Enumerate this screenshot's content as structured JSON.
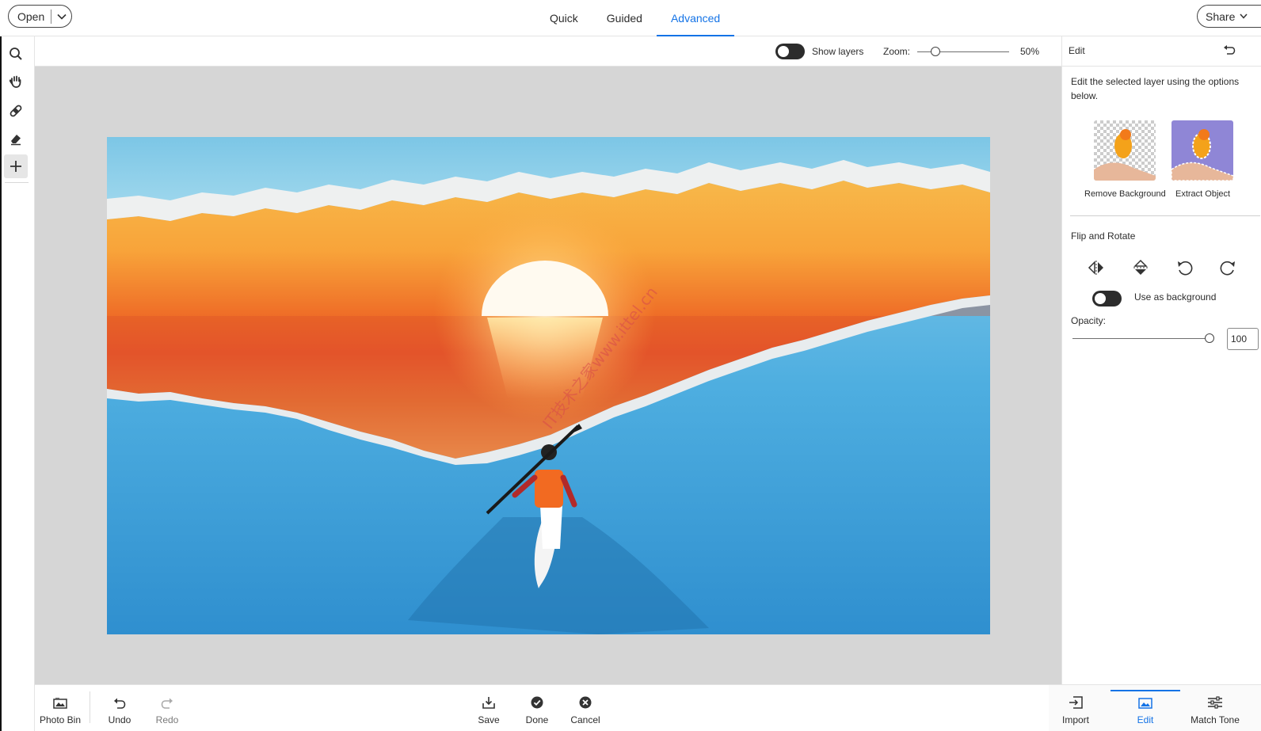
{
  "topbar": {
    "open_label": "Open",
    "tabs": [
      {
        "label": "Quick",
        "active": false
      },
      {
        "label": "Guided",
        "active": false
      },
      {
        "label": "Advanced",
        "active": true
      }
    ],
    "share_label": "Share"
  },
  "tools": [
    {
      "name": "zoom",
      "icon": "magnifier-icon"
    },
    {
      "name": "hand",
      "icon": "hand-icon"
    },
    {
      "name": "spot-healing",
      "icon": "bandage-icon"
    },
    {
      "name": "eraser",
      "icon": "eraser-icon"
    },
    {
      "name": "move",
      "icon": "move-icon",
      "active": true
    }
  ],
  "options": {
    "show_layers_label": "Show layers",
    "show_layers_on": false,
    "zoom_label": "Zoom:",
    "zoom_value": "50%",
    "zoom_fraction": 0.2
  },
  "canvas": {
    "watermark": "IT技术之家www.ittel.cn"
  },
  "panel": {
    "title": "Edit",
    "description": "Edit the selected layer using the options below.",
    "remove_background_label": "Remove Background",
    "extract_object_label": "Extract Object",
    "flip_rotate_label": "Flip and Rotate",
    "use_as_background_label": "Use as background",
    "use_as_background_on": false,
    "opacity_label": "Opacity:",
    "opacity_value": "100",
    "opacity_fraction": 1.0
  },
  "bottombar": {
    "photo_bin": "Photo Bin",
    "undo": "Undo",
    "redo": "Redo",
    "save": "Save",
    "done": "Done",
    "cancel": "Cancel",
    "import": "Import",
    "edit": "Edit",
    "match_tone": "Match Tone"
  },
  "colors": {
    "accent": "#1473e6",
    "canvas_bg": "#d6d6d6"
  }
}
